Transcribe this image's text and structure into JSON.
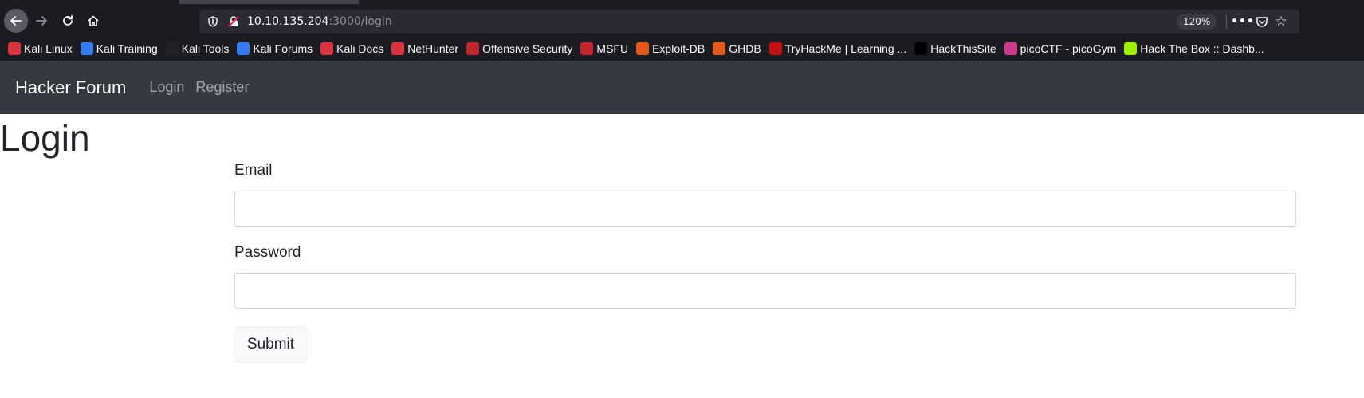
{
  "browser": {
    "url_host": "10.10.135.204",
    "url_path": ":3000/login",
    "zoom": "120%",
    "bookmarks": [
      {
        "label": "Kali Linux",
        "icon": "kali-icon",
        "color": "#d9333f"
      },
      {
        "label": "Kali Training",
        "icon": "kali-training-icon",
        "color": "#367bf0"
      },
      {
        "label": "Kali Tools",
        "icon": "kali-tools-icon",
        "color": "#222222"
      },
      {
        "label": "Kali Forums",
        "icon": "kali-forums-icon",
        "color": "#367bf0"
      },
      {
        "label": "Kali Docs",
        "icon": "kali-docs-icon",
        "color": "#d9333f"
      },
      {
        "label": "NetHunter",
        "icon": "nethunter-icon",
        "color": "#d9333f"
      },
      {
        "label": "Offensive Security",
        "icon": "offsec-icon",
        "color": "#c0262d"
      },
      {
        "label": "MSFU",
        "icon": "msfu-icon",
        "color": "#c0262d"
      },
      {
        "label": "Exploit-DB",
        "icon": "exploit-db-icon",
        "color": "#e25a1c"
      },
      {
        "label": "GHDB",
        "icon": "ghdb-icon",
        "color": "#e25a1c"
      },
      {
        "label": "TryHackMe | Learning ...",
        "icon": "tryhackme-icon",
        "color": "#c11111"
      },
      {
        "label": "HackThisSite",
        "icon": "hackthissite-icon",
        "color": "#000000"
      },
      {
        "label": "picoCTF - picoGym",
        "icon": "picoctf-icon",
        "color": "#c83c8b"
      },
      {
        "label": "Hack The Box :: Dashb...",
        "icon": "hackthebox-icon",
        "color": "#9fef00"
      }
    ]
  },
  "site": {
    "brand": "Hacker Forum",
    "nav": {
      "login": "Login",
      "register": "Register"
    }
  },
  "page": {
    "title": "Login",
    "email_label": "Email",
    "email_value": "",
    "password_label": "Password",
    "password_value": "",
    "submit_label": "Submit"
  }
}
